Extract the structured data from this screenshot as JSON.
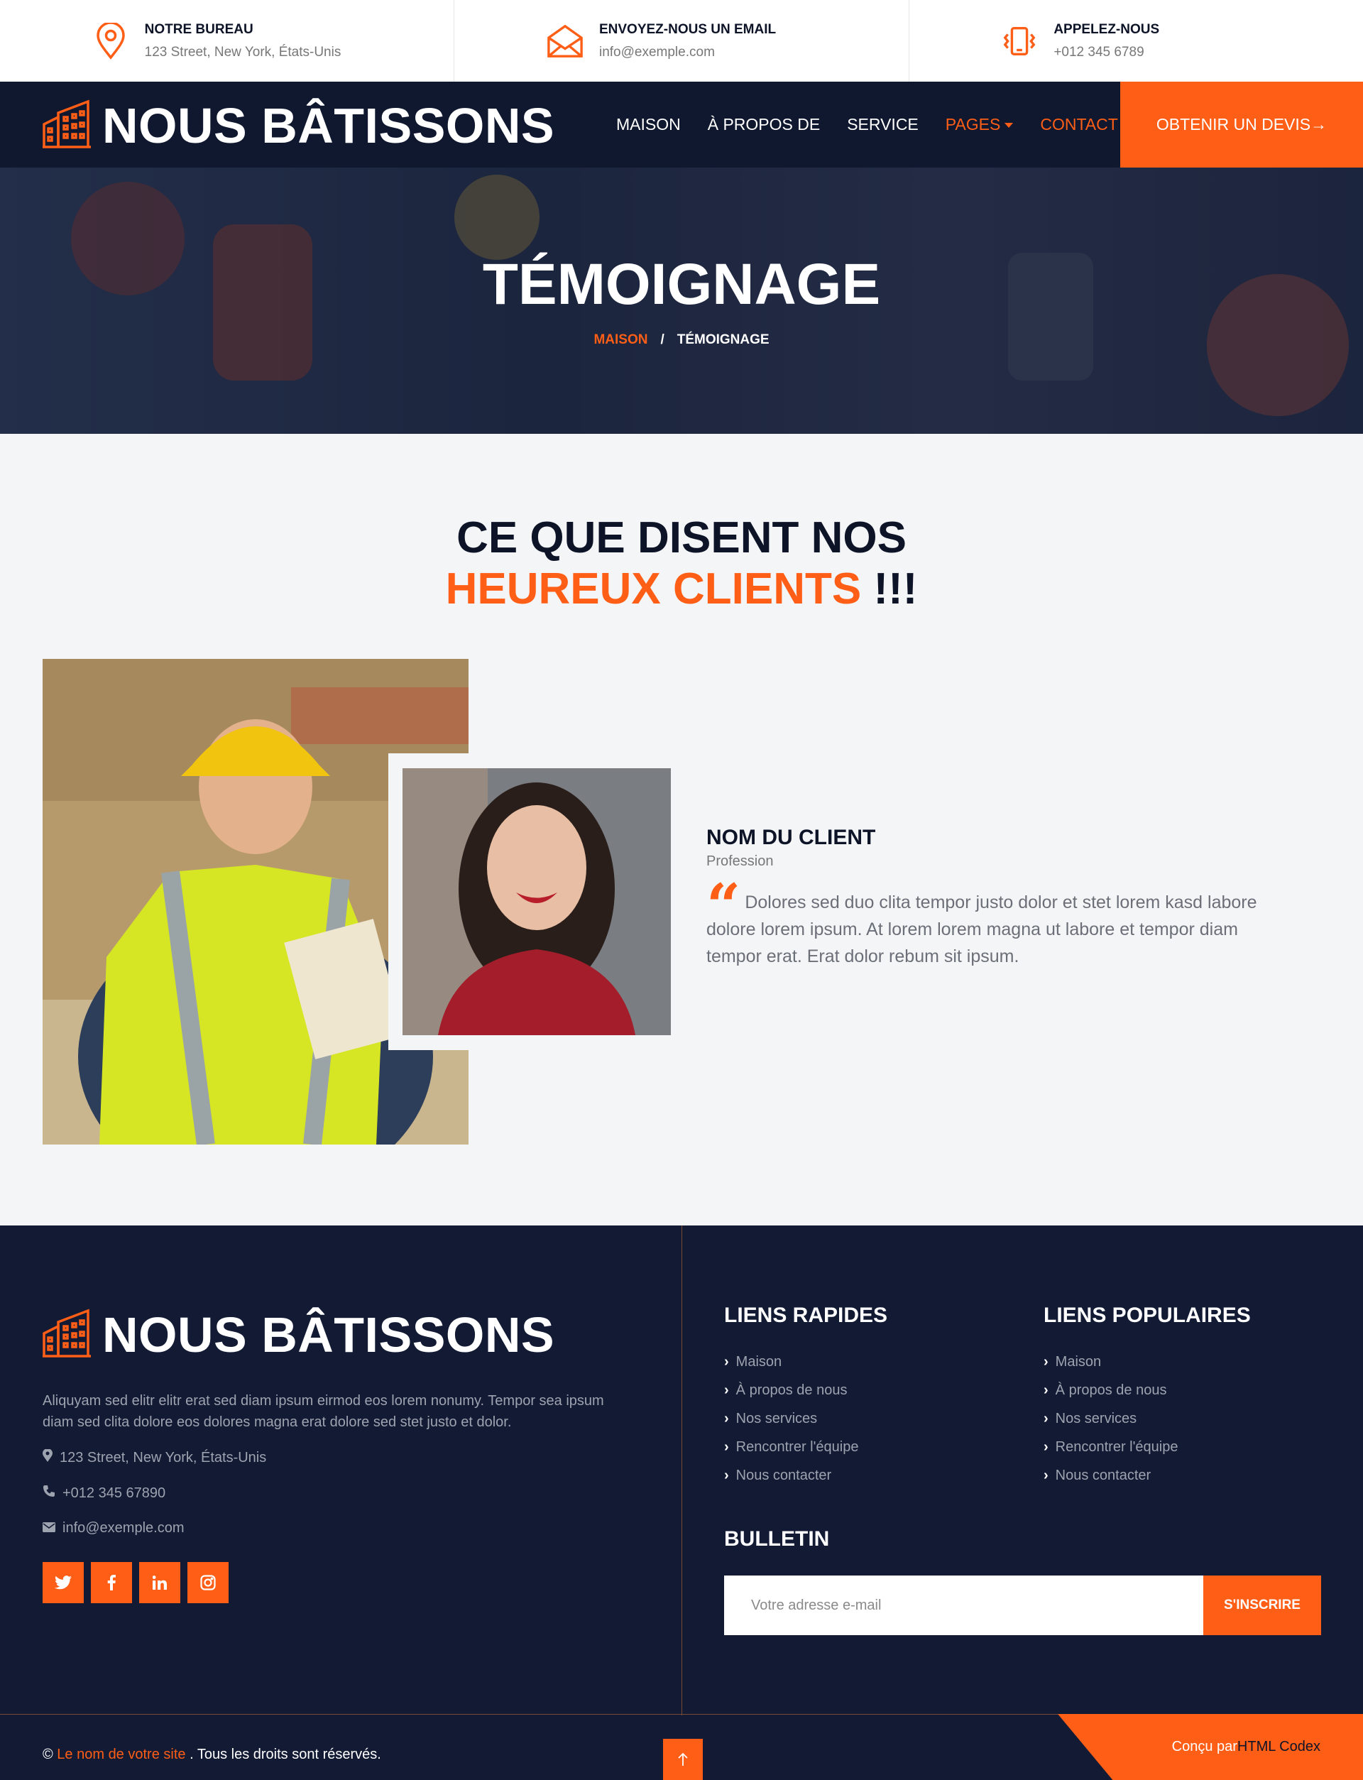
{
  "topbar": {
    "office": {
      "title": "NOTRE BUREAU",
      "value": "123 Street, New York, États-Unis",
      "icon": "map-pin-icon"
    },
    "email": {
      "title": "ENVOYEZ-NOUS UN EMAIL",
      "value": "info@exemple.com",
      "icon": "envelope-icon"
    },
    "phone": {
      "title": "APPELEZ-NOUS",
      "value": "+012 345 6789",
      "icon": "phone-vibrate-icon"
    }
  },
  "brand": {
    "name": "NOUS BÂTISSONS",
    "icon": "building-icon"
  },
  "nav": {
    "items": [
      {
        "label": "MAISON",
        "active": false
      },
      {
        "label": "À PROPOS DE",
        "active": false
      },
      {
        "label": "SERVICE",
        "active": false
      },
      {
        "label": "PAGES",
        "active": true,
        "dropdown": true
      },
      {
        "label": "CONTACT",
        "active": true
      }
    ],
    "quote_button": "OBTENIR UN DEVIS→"
  },
  "hero": {
    "title": "TÉMOIGNAGE",
    "breadcrumb_home": "MAISON",
    "breadcrumb_sep": "/",
    "breadcrumb_current": "TÉMOIGNAGE"
  },
  "testimonial": {
    "heading_line1": "CE QUE DISENT NOS",
    "heading_highlight": "HEUREUX CLIENTS",
    "heading_suffix": " !!!",
    "client_name": "NOM DU CLIENT",
    "client_profession": "Profession",
    "quote_text": "Dolores sed duo clita tempor justo dolor et stet lorem kasd labore dolore lorem ipsum. At lorem lorem magna ut labore et tempor diam tempor erat. Erat dolor rebum sit ipsum."
  },
  "footer": {
    "brand_name": "NOUS BÂTISSONS",
    "description": "Aliquyam sed elitr elitr erat sed diam ipsum eirmod eos lorem nonumy. Tempor sea ipsum diam sed clita dolore eos dolores magna erat dolore sed stet justo et dolor.",
    "address": "123 Street, New York, États-Unis",
    "phone": "+012 345 67890",
    "email": "info@exemple.com",
    "socials": [
      "twitter-icon",
      "facebook-icon",
      "linkedin-icon",
      "instagram-icon"
    ],
    "quick_links_title": "LIENS RAPIDES",
    "quick_links": [
      "Maison",
      "À propos de nous",
      "Nos services",
      "Rencontrer l'équipe",
      "Nous contacter"
    ],
    "popular_links_title": "LIENS POPULAIRES",
    "popular_links": [
      "Maison",
      "À propos de nous",
      "Nos services",
      "Rencontrer l'équipe",
      "Nous contacter"
    ],
    "newsletter_title": "BULLETIN",
    "newsletter_placeholder": "Votre adresse e-mail",
    "newsletter_button": "S'INSCRIRE",
    "copyright_prefix": "© ",
    "copyright_site": "Le nom de votre site",
    "copyright_suffix": " . Tous les droits sont réservés.",
    "designed_prefix": "Conçu par ",
    "designed_by": "HTML Codex"
  },
  "colors": {
    "accent": "#fe5e16",
    "navy": "#101830"
  }
}
